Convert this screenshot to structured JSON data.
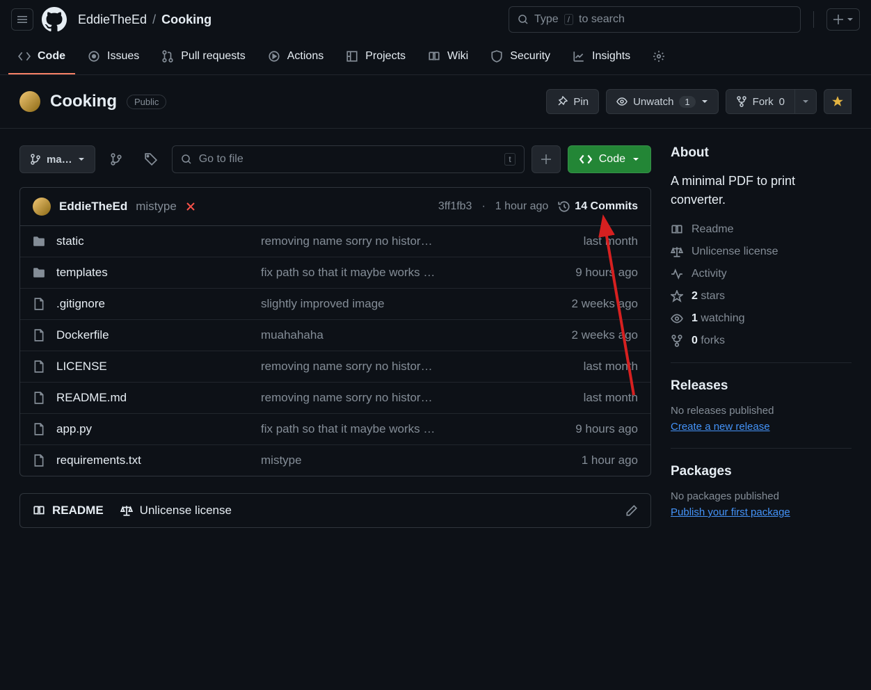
{
  "breadcrumb": {
    "owner": "EddieTheEd",
    "repo": "Cooking"
  },
  "search": {
    "prefix": "Type",
    "slash": "/",
    "suffix": "to search"
  },
  "tabs": [
    {
      "label": "Code"
    },
    {
      "label": "Issues"
    },
    {
      "label": "Pull requests"
    },
    {
      "label": "Actions"
    },
    {
      "label": "Projects"
    },
    {
      "label": "Wiki"
    },
    {
      "label": "Security"
    },
    {
      "label": "Insights"
    }
  ],
  "repo": {
    "name": "Cooking",
    "visibility": "Public",
    "pin": "Pin",
    "unwatch": "Unwatch",
    "watch_count": "1",
    "fork": "Fork",
    "fork_count": "0"
  },
  "toolbar": {
    "branch": "ma…",
    "goto_placeholder": "Go to file",
    "t_key": "t",
    "code_label": "Code"
  },
  "commit": {
    "author": "EddieTheEd",
    "message": "mistype",
    "sha": "3ff1fb3",
    "time": "1 hour ago",
    "count_label": "14 Commits"
  },
  "files": [
    {
      "type": "dir",
      "name": "static",
      "msg": "removing name sorry no histor…",
      "time": "last month"
    },
    {
      "type": "dir",
      "name": "templates",
      "msg": "fix path so that it maybe works …",
      "time": "9 hours ago"
    },
    {
      "type": "file",
      "name": ".gitignore",
      "msg": "slightly improved image",
      "time": "2 weeks ago"
    },
    {
      "type": "file",
      "name": "Dockerfile",
      "msg": "muahahaha",
      "time": "2 weeks ago"
    },
    {
      "type": "file",
      "name": "LICENSE",
      "msg": "removing name sorry no histor…",
      "time": "last month"
    },
    {
      "type": "file",
      "name": "README.md",
      "msg": "removing name sorry no histor…",
      "time": "last month"
    },
    {
      "type": "file",
      "name": "app.py",
      "msg": "fix path so that it maybe works …",
      "time": "9 hours ago"
    },
    {
      "type": "file",
      "name": "requirements.txt",
      "msg": "mistype",
      "time": "1 hour ago"
    }
  ],
  "readme": {
    "label": "README",
    "license": "Unlicense license"
  },
  "about": {
    "heading": "About",
    "desc": "A minimal PDF to print converter.",
    "readme": "Readme",
    "license": "Unlicense license",
    "activity": "Activity",
    "stars_n": "2",
    "stars_l": "stars",
    "watch_n": "1",
    "watch_l": "watching",
    "forks_n": "0",
    "forks_l": "forks"
  },
  "releases": {
    "heading": "Releases",
    "none": "No releases published",
    "link": "Create a new release"
  },
  "packages": {
    "heading": "Packages",
    "none": "No packages published",
    "link": "Publish your first package"
  }
}
